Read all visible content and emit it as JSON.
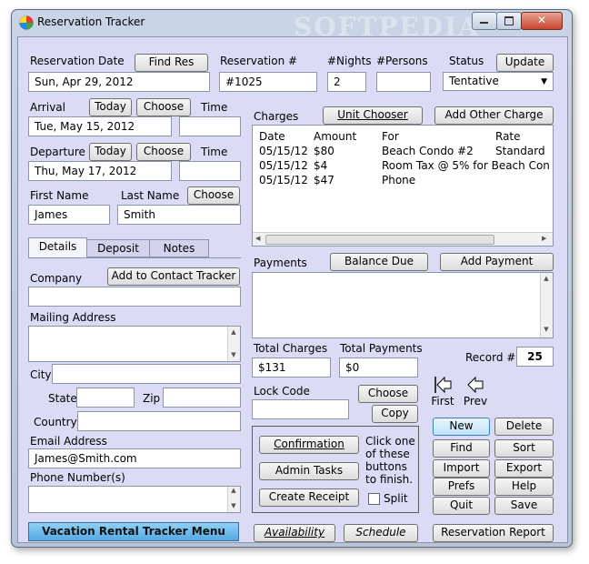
{
  "window": {
    "title": "Reservation Tracker",
    "watermark": "SOFTPEDIA"
  },
  "reservation": {
    "date_label": "Reservation Date",
    "date_value": "Sun, Apr 29, 2012",
    "find_res_button": "Find Res",
    "number_label": "Reservation #",
    "number_value": "#1025",
    "nights_label": "#Nights",
    "nights_value": "2",
    "persons_label": "#Persons",
    "persons_value": "",
    "status_label": "Status",
    "status_value": "Tentative",
    "update_button": "Update"
  },
  "arrival": {
    "label": "Arrival",
    "today_button": "Today",
    "choose_button": "Choose",
    "time_label": "Time",
    "date_value": "Tue, May 15, 2012",
    "time_value": ""
  },
  "departure": {
    "label": "Departure",
    "today_button": "Today",
    "choose_button": "Choose",
    "time_label": "Time",
    "date_value": "Thu, May 17, 2012",
    "time_value": ""
  },
  "guest": {
    "first_name_label": "First Name",
    "last_name_label": "Last Name",
    "choose_button": "Choose",
    "first_name": "James",
    "last_name": "Smith"
  },
  "tabs": [
    {
      "label": "Details"
    },
    {
      "label": "Deposit"
    },
    {
      "label": "Notes"
    }
  ],
  "details": {
    "company_label": "Company",
    "add_contact_button": "Add to Contact Tracker",
    "company_value": "",
    "mailing_label": "Mailing Address",
    "city_label": "City",
    "state_label": "State",
    "zip_label": "Zip",
    "country_label": "Country",
    "email_label": "Email Address",
    "email_value": "James@Smith.com",
    "phone_label": "Phone Number(s)"
  },
  "charges": {
    "label": "Charges",
    "unit_chooser_button": "Unit Chooser",
    "add_other_charge_button": "Add Other Charge",
    "columns": [
      "Date",
      "Amount",
      "For",
      "Rate"
    ],
    "rows": [
      [
        "05/15/12",
        "$80",
        "Beach Condo #2",
        "Standard"
      ],
      [
        "05/15/12",
        "$4",
        "Room Tax @ 5% for Beach Con",
        ""
      ],
      [
        "05/15/12",
        "$47",
        "Phone",
        ""
      ]
    ]
  },
  "payments": {
    "label": "Payments",
    "balance_due_button": "Balance Due",
    "add_payment_button": "Add Payment"
  },
  "totals": {
    "charges_label": "Total Charges",
    "charges_value": "$131",
    "payments_label": "Total Payments",
    "payments_value": "$0",
    "record_label": "Record #",
    "record_value": "25"
  },
  "lock": {
    "label": "Lock Code",
    "value": "",
    "choose_button": "Choose",
    "copy_button": "Copy"
  },
  "nav": {
    "first_label": "First",
    "prev_label": "Prev"
  },
  "finish": {
    "confirmation_button": "Confirmation",
    "admin_tasks_button": "Admin Tasks",
    "create_receipt_button": "Create Receipt",
    "hint_line1": "Click one",
    "hint_line2": "of these",
    "hint_line3": "buttons",
    "hint_line4": "to finish.",
    "split_label": "Split"
  },
  "actions": {
    "new": "New",
    "delete": "Delete",
    "find": "Find",
    "sort": "Sort",
    "import": "Import",
    "export": "Export",
    "prefs": "Prefs",
    "help": "Help",
    "quit": "Quit",
    "save": "Save"
  },
  "bottom": {
    "menu_button": "Vacation Rental Tracker Menu",
    "availability_button": "Availability",
    "schedule_button": "Schedule",
    "report_button": "Reservation Report"
  }
}
